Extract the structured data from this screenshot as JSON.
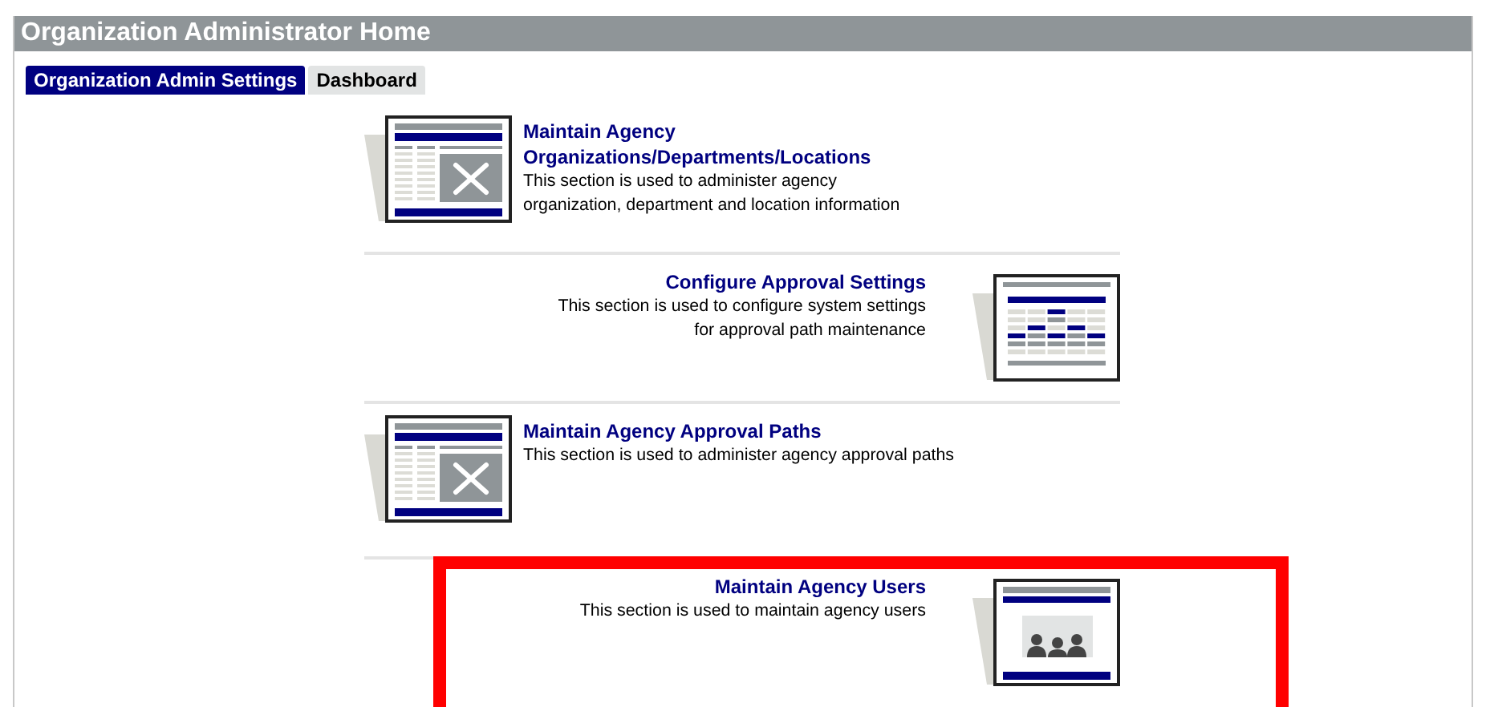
{
  "header": {
    "title": "Organization Administrator Home"
  },
  "tabs": [
    {
      "label": "Organization Admin Settings",
      "selected": true
    },
    {
      "label": "Dashboard",
      "selected": false
    }
  ],
  "sections": [
    {
      "title": "Maintain Agency Organizations/Departments/Locations",
      "description": "This section is used to administer agency organization, department and location information",
      "kind": "tools-left",
      "highlighted": false
    },
    {
      "title": "Configure Approval Settings",
      "description": "This section is used to configure system settings for approval path maintenance",
      "kind": "grid-right",
      "highlighted": false
    },
    {
      "title": "Maintain Agency Approval Paths",
      "description": "This section is used to administer agency approval paths",
      "kind": "tools-left",
      "highlighted": false
    },
    {
      "title": "Maintain Agency Users",
      "description": "This section is used to maintain agency users",
      "kind": "users-right",
      "highlighted": true
    }
  ]
}
